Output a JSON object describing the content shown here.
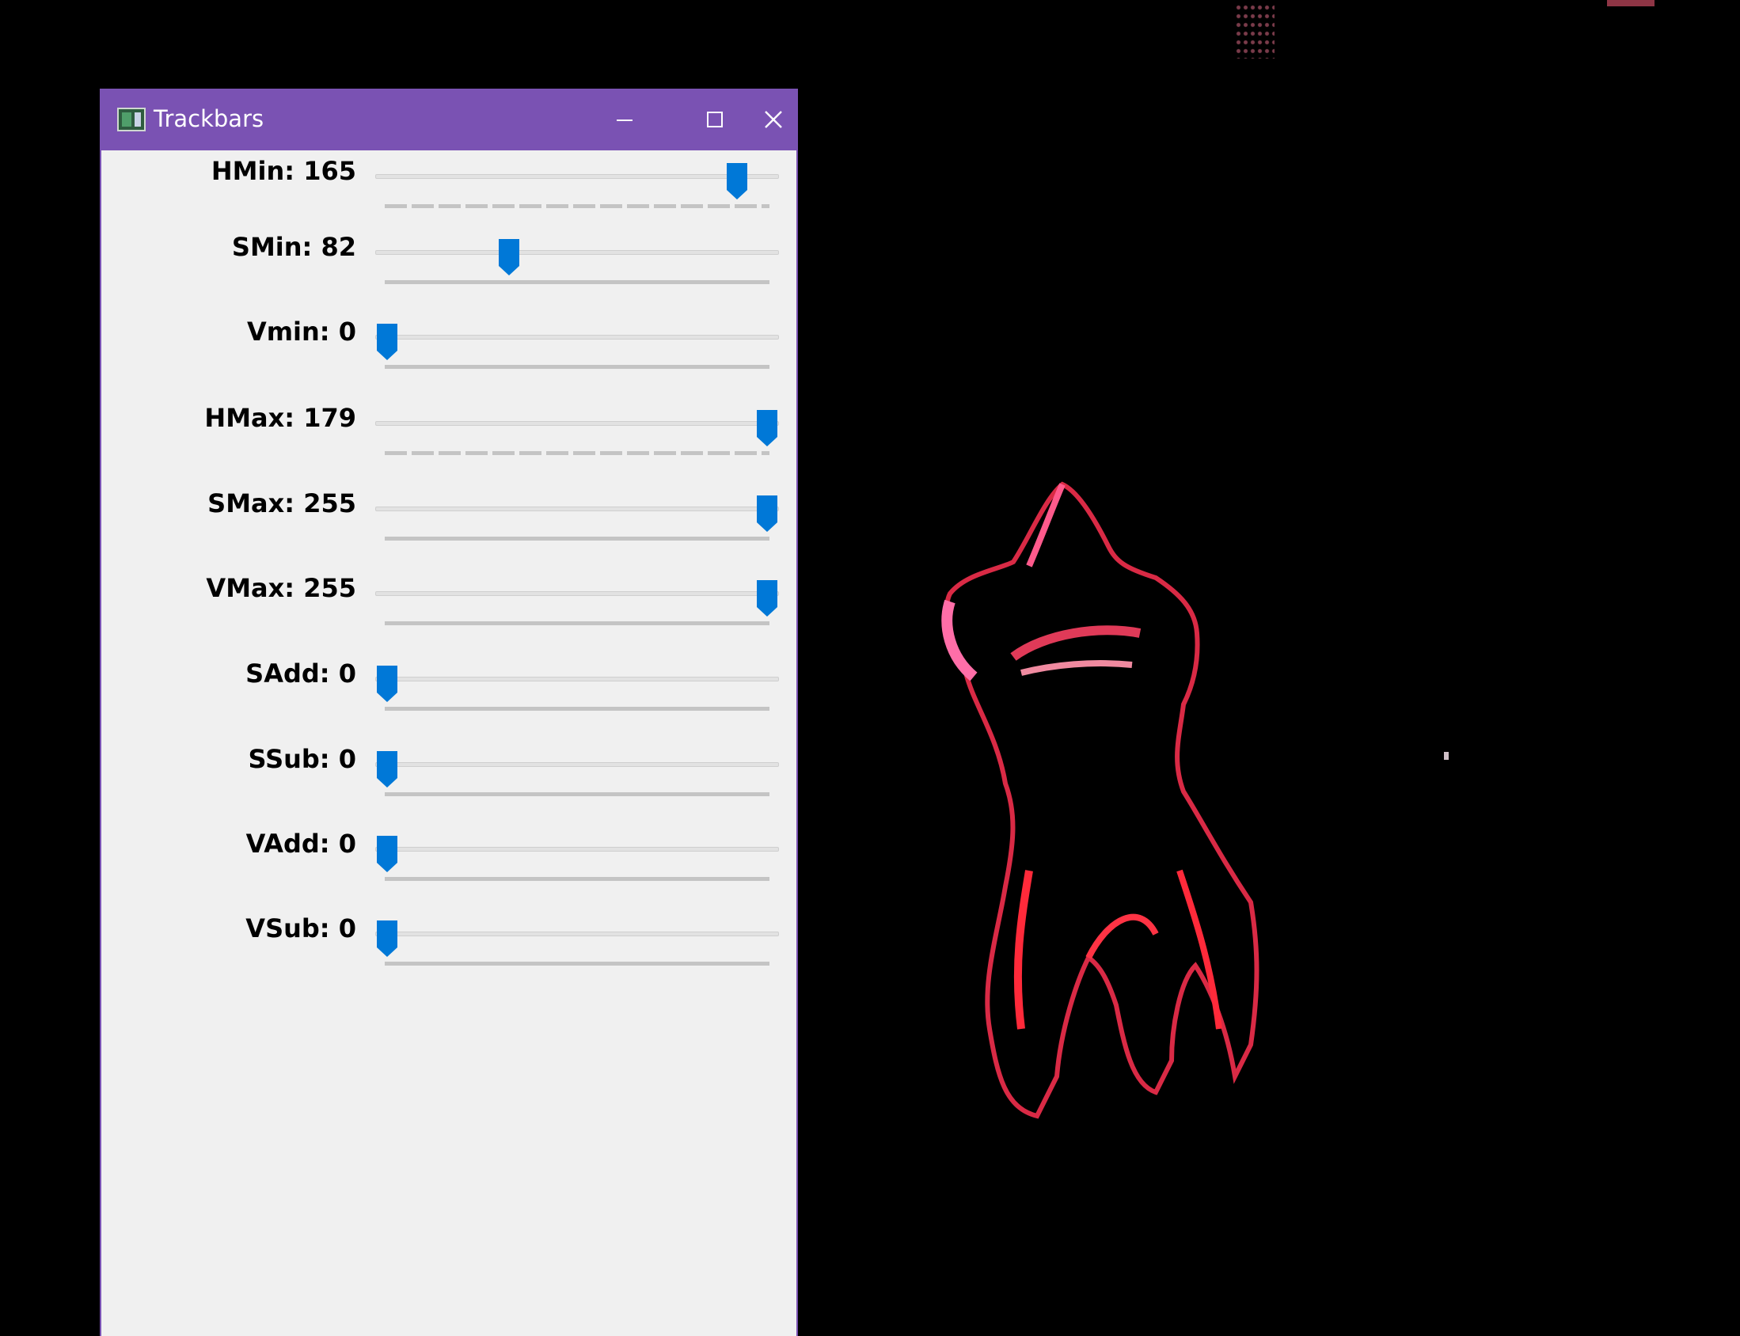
{
  "window": {
    "title": "Trackbars",
    "controls": {
      "minimize": "minimize-icon",
      "maximize": "maximize-icon",
      "close": "close-icon"
    }
  },
  "colors": {
    "titlebar": "#7a52b3",
    "panel": "#f0f0f0",
    "thumb": "#0078d7",
    "backdrop": "#000000",
    "silhouette": "#e8304c"
  },
  "trackbars": [
    {
      "label": "HMin: 165",
      "value": 165,
      "max": 179,
      "ticks": true
    },
    {
      "label": "SMin: 82",
      "value": 82,
      "max": 255,
      "ticks": false
    },
    {
      "label": "Vmin: 0",
      "value": 0,
      "max": 255,
      "ticks": false
    },
    {
      "label": "HMax: 179",
      "value": 179,
      "max": 179,
      "ticks": true
    },
    {
      "label": "SMax: 255",
      "value": 255,
      "max": 255,
      "ticks": false
    },
    {
      "label": "VMax: 255",
      "value": 255,
      "max": 255,
      "ticks": false
    },
    {
      "label": "SAdd: 0",
      "value": 0,
      "max": 255,
      "ticks": false
    },
    {
      "label": "SSub: 0",
      "value": 0,
      "max": 255,
      "ticks": false
    },
    {
      "label": "VAdd: 0",
      "value": 0,
      "max": 255,
      "ticks": false
    },
    {
      "label": "VSub: 0",
      "value": 0,
      "max": 255,
      "ticks": false
    }
  ]
}
